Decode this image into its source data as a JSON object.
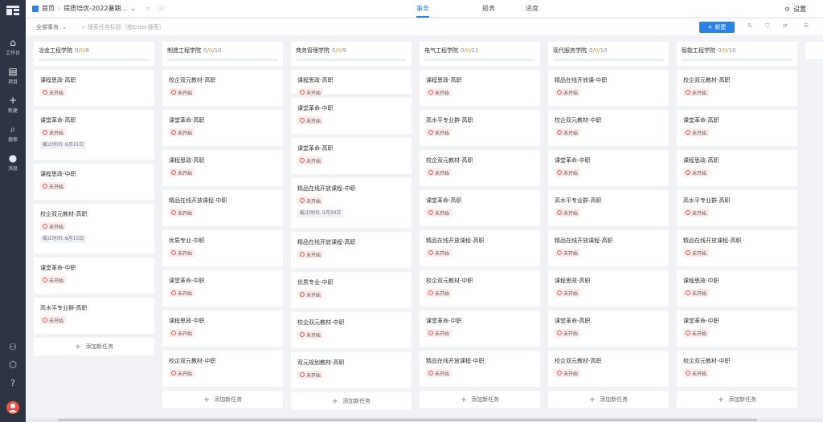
{
  "sidebar": {
    "items": [
      {
        "label": "工作台",
        "icon": "home-icon"
      },
      {
        "label": "项目",
        "icon": "folder-icon"
      },
      {
        "label": "新建",
        "icon": "plus-icon"
      },
      {
        "label": "搜索",
        "icon": "search-icon"
      },
      {
        "label": "消息",
        "icon": "message-icon"
      }
    ]
  },
  "topbar": {
    "home": "首页",
    "project": "提质培优-2022暑期...",
    "tabs": [
      "事务",
      "报表",
      "进度"
    ],
    "settings": "设置"
  },
  "toolbar": {
    "filter": "全部事务",
    "search_placeholder": "搜索任务标题（按Enter搜索）",
    "new_button": "新建"
  },
  "status_label": "未开始",
  "add_task_label": "添加新任务",
  "columns": [
    {
      "name": "冶金工程学院",
      "count_prefix": "0/",
      "count_mid": "0",
      "count_suffix": "/6",
      "cards": [
        {
          "title": "课程思政-高职"
        },
        {
          "title": "课堂革命-高职",
          "due": "截止时间: 8月31日"
        },
        {
          "title": "课程思政-中职"
        },
        {
          "title": "校企双元教材-高职",
          "due": "截止时间: 8月15日"
        },
        {
          "title": "课堂革命-中职"
        },
        {
          "title": "高水平专业群-高职"
        }
      ]
    },
    {
      "name": "制造工程学院",
      "count_prefix": "0/",
      "count_mid": "0",
      "count_suffix": "/10",
      "cards": [
        {
          "title": "校企双元教材-高职"
        },
        {
          "title": "课堂革命-高职"
        },
        {
          "title": "课程思政-高职"
        },
        {
          "title": "精品在线开放课程-中职"
        },
        {
          "title": "优质专业-中职"
        },
        {
          "title": "课堂革命-中职"
        },
        {
          "title": "课程思政-中职"
        },
        {
          "title": "校企双元教材-中职"
        }
      ]
    },
    {
      "name": "商务管理学院",
      "count_prefix": "0/",
      "count_mid": "0",
      "count_suffix": "/9",
      "cards": [
        {
          "title": "课程思政-高职"
        },
        {
          "title": "课堂革命-中职"
        },
        {
          "title": "课堂革命-高职"
        },
        {
          "title": "精品在线开放课程-中职",
          "due": "截止时间: 9月30日"
        },
        {
          "title": "精品在线开放课程-高职"
        },
        {
          "title": "优质专业-中职"
        },
        {
          "title": "校企双元教材-中职"
        },
        {
          "title": "双元规划教材-高职"
        }
      ]
    },
    {
      "name": "电气工程学院",
      "count_prefix": "0/",
      "count_mid": "0",
      "count_suffix": "/11",
      "cards": [
        {
          "title": "课程思政-高职"
        },
        {
          "title": "高水平专业群-高职"
        },
        {
          "title": "校企双元教材-高职"
        },
        {
          "title": "课堂革命-高职"
        },
        {
          "title": "精品在线开放课程-高职"
        },
        {
          "title": "校企双元教材-中职"
        },
        {
          "title": "课堂革命-中职"
        },
        {
          "title": "精品在线开放课程-中职"
        }
      ]
    },
    {
      "name": "现代服务学院",
      "count_prefix": "0/",
      "count_mid": "0",
      "count_suffix": "/10",
      "cards": [
        {
          "title": "精品在线开放课-中职"
        },
        {
          "title": "校企双元教材-中职"
        },
        {
          "title": "课堂革命-中职"
        },
        {
          "title": "高水平专业群-高职"
        },
        {
          "title": "精品在线开放课程-高职"
        },
        {
          "title": "课程思政-高职"
        },
        {
          "title": "课堂革命-高职"
        },
        {
          "title": "校企双元教材-高职"
        }
      ]
    },
    {
      "name": "智能工程学院",
      "count_prefix": "0/",
      "count_mid": "0",
      "count_suffix": "/10",
      "cards": [
        {
          "title": "校企双元教材-高职"
        },
        {
          "title": "课堂革命-高职"
        },
        {
          "title": "课程思政-高职"
        },
        {
          "title": "高水平专业群-高职"
        },
        {
          "title": "精品在线开放课程-高职"
        },
        {
          "title": "课程思政-中职"
        },
        {
          "title": "课堂革命-中职"
        },
        {
          "title": "校企双元教材-中职"
        }
      ]
    }
  ]
}
